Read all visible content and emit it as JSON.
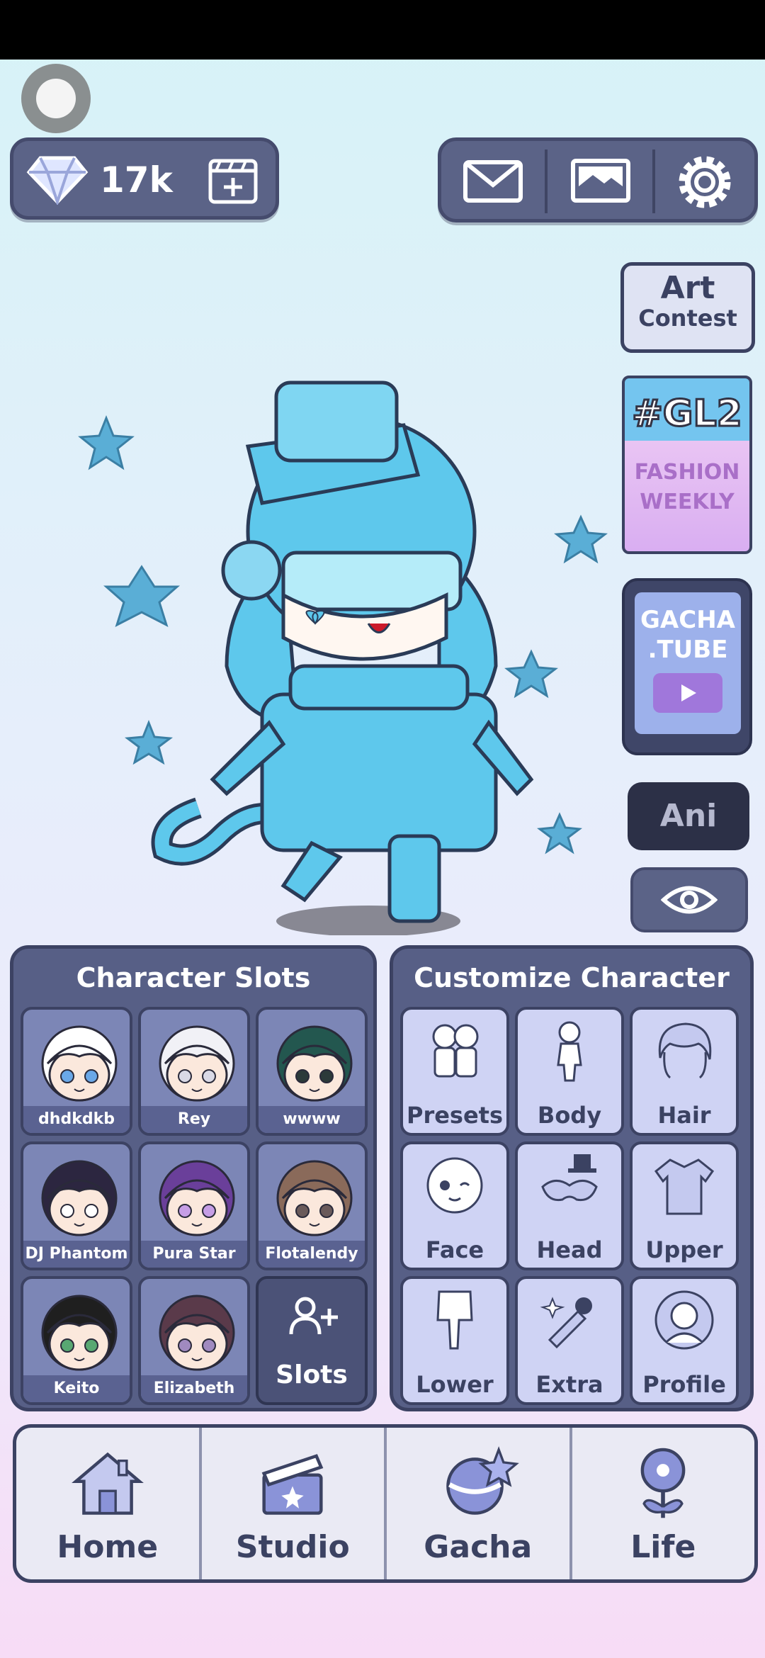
{
  "top_bar": {
    "gem_count": "17k"
  },
  "side_menu": {
    "art_contest": {
      "line1": "Art",
      "line2": "Contest"
    },
    "fashion_weekly": {
      "tag": "#GL2",
      "line1": "FASHION",
      "line2": "WEEKLY"
    },
    "gacha_tube": {
      "line1": "GACHA",
      "line2": ".TUBE"
    },
    "ani_label": "Ani"
  },
  "character_slots": {
    "title": "Character Slots",
    "slots": [
      {
        "name": "dhdkdkb",
        "hair": "#ffffff",
        "eye": "#6aa8e8"
      },
      {
        "name": "Rey",
        "hair": "#f1f1f6",
        "eye": "#d9d9e6"
      },
      {
        "name": "wwww",
        "hair": "#23574f",
        "eye": "#2c3a3a"
      },
      {
        "name": "DJ Phantom",
        "hair": "#2c2640",
        "eye": "#ffffff"
      },
      {
        "name": "Pura Star",
        "hair": "#6a3f9a",
        "eye": "#c69ee6"
      },
      {
        "name": "Flotalendy",
        "hair": "#8a6a5a",
        "eye": "#6a5a5a"
      },
      {
        "name": "Keito",
        "hair": "#1f1f1f",
        "eye": "#58a872"
      },
      {
        "name": "Elizabeth",
        "hair": "#5a3a4a",
        "eye": "#a08ac0"
      }
    ],
    "add_label": "Slots"
  },
  "customize": {
    "title": "Customize Character",
    "items": [
      {
        "label": "Presets",
        "icon": "presets-icon"
      },
      {
        "label": "Body",
        "icon": "body-icon"
      },
      {
        "label": "Hair",
        "icon": "hair-icon"
      },
      {
        "label": "Face",
        "icon": "face-icon"
      },
      {
        "label": "Head",
        "icon": "head-icon"
      },
      {
        "label": "Upper",
        "icon": "upper-icon"
      },
      {
        "label": "Lower",
        "icon": "lower-icon"
      },
      {
        "label": "Extra",
        "icon": "extra-icon"
      },
      {
        "label": "Profile",
        "icon": "profile-icon"
      }
    ]
  },
  "bottom_nav": [
    {
      "label": "Home",
      "icon": "home-icon"
    },
    {
      "label": "Studio",
      "icon": "studio-icon"
    },
    {
      "label": "Gacha",
      "icon": "gacha-icon"
    },
    {
      "label": "Life",
      "icon": "life-icon"
    }
  ],
  "colors": {
    "panel": "#575f86",
    "outline": "#3c4263",
    "character": "#5ec8ec"
  }
}
